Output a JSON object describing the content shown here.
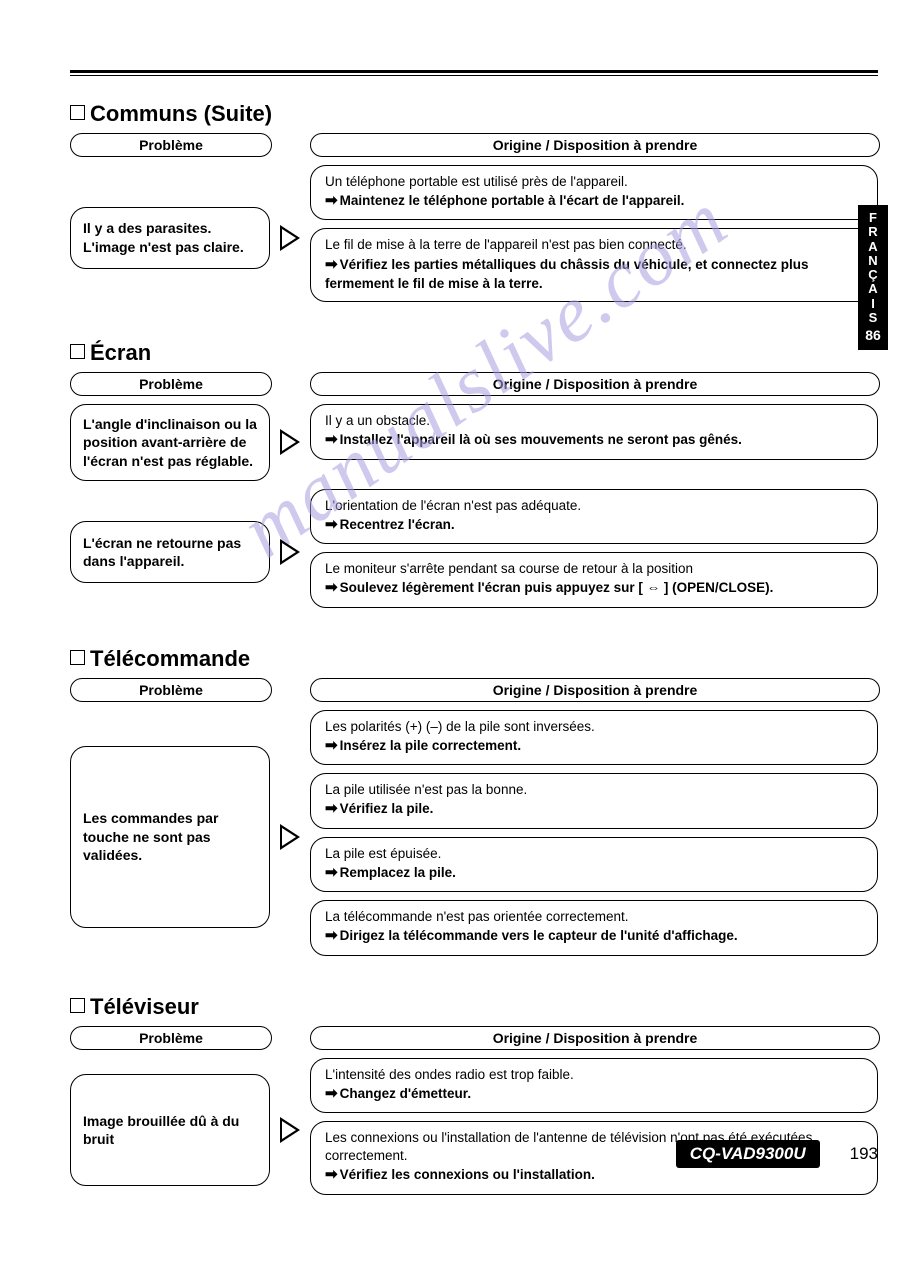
{
  "sideTab": {
    "lang": "FRANÇAIS",
    "page": "86"
  },
  "header": {
    "problemLabel": "Problème",
    "originLabel": "Origine / Disposition à prendre"
  },
  "sections": [
    {
      "title": "Communs (Suite)",
      "groups": [
        {
          "problem": "Il y a des parasites. L'image n'est pas claire.",
          "solutions": [
            {
              "origin": "Un téléphone portable est utilisé près de l'appareil.",
              "disp": "Maintenez le téléphone portable à l'écart de l'appareil."
            },
            {
              "origin": "Le fil de mise à la terre de l'appareil n'est pas bien connecté.",
              "disp": "Vérifiez les parties métalliques du châssis du véhicule, et connectez plus fermement le fil de mise à la terre."
            }
          ]
        }
      ]
    },
    {
      "title": "Écran",
      "groups": [
        {
          "problem": "L'angle d'inclinaison ou la position avant-arrière de l'écran n'est pas réglable.",
          "solutions": [
            {
              "origin": "Il y a un obstacle.",
              "disp": "Installez l'appareil là où ses mouvements ne seront pas gênés."
            }
          ]
        },
        {
          "problem": "L'écran ne retourne pas dans l'appareil.",
          "solutions": [
            {
              "origin": "L'orientation de l'écran n'est pas adéquate.",
              "disp": "Recentrez l'écran."
            },
            {
              "origin": "Le moniteur s'arrête pendant sa course de retour à la position",
              "disp": "Soulevez légèrement l'écran puis appuyez sur [ ⇔ ] (OPEN/CLOSE)."
            }
          ]
        }
      ]
    },
    {
      "title": "Télécommande",
      "groups": [
        {
          "problem": "Les commandes par touche ne sont pas validées.",
          "solutions": [
            {
              "origin": "Les polarités (+) (–) de la pile sont inversées.",
              "disp": "Insérez la pile correctement."
            },
            {
              "origin": "La pile utilisée n'est pas la bonne.",
              "disp": "Vérifiez la pile."
            },
            {
              "origin": "La pile est épuisée.",
              "disp": "Remplacez la pile."
            },
            {
              "origin": "La télécommande n'est pas orientée correctement.",
              "disp": "Dirigez la télécommande vers le capteur de l'unité d'affichage."
            }
          ]
        }
      ]
    },
    {
      "title": "Téléviseur",
      "groups": [
        {
          "problem": "Image brouillée dû à du bruit",
          "solutions": [
            {
              "origin": "L'intensité des ondes radio est trop faible.",
              "disp": "Changez d'émetteur."
            },
            {
              "origin": "Les connexions ou l'installation de l'antenne de télévision n'ont pas été exécutées correctement.",
              "disp": "Vérifiez les connexions ou l'installation."
            }
          ]
        }
      ]
    }
  ],
  "footer": {
    "model": "CQ-VAD9300U",
    "page": "193"
  },
  "watermark": "manualslive.com"
}
